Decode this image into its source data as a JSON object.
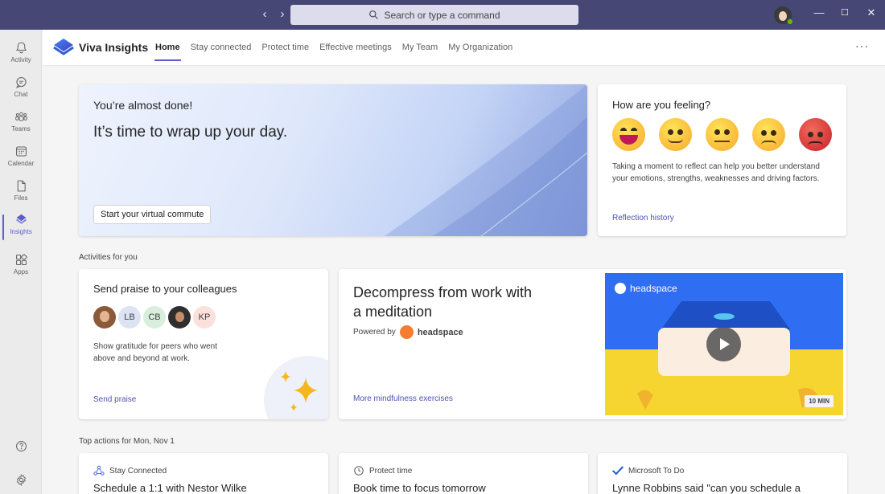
{
  "titlebar": {
    "search_placeholder": "Search or type a command",
    "back_icon": "chevron-left",
    "forward_icon": "chevron-right",
    "min_symbol": "—",
    "max_symbol": "☐",
    "close_symbol": "✕"
  },
  "rail": {
    "items": [
      {
        "label": "Activity",
        "icon": "bell-icon"
      },
      {
        "label": "Chat",
        "icon": "chat-icon"
      },
      {
        "label": "Teams",
        "icon": "teams-icon"
      },
      {
        "label": "Calendar",
        "icon": "calendar-icon"
      },
      {
        "label": "Files",
        "icon": "file-icon"
      },
      {
        "label": "Insights",
        "icon": "insights-icon",
        "active": true
      },
      {
        "label": "Apps",
        "icon": "apps-icon"
      }
    ],
    "help_icon": "help-icon",
    "settings_icon": "gear-icon"
  },
  "app": {
    "name": "Viva Insights",
    "tabs": [
      "Home",
      "Stay connected",
      "Protect time",
      "Effective meetings",
      "My Team",
      "My Organization"
    ],
    "active_tab": "Home",
    "more": "···"
  },
  "hero": {
    "title": "You’re almost done!",
    "subtitle": "It’s time to wrap up your day.",
    "button": "Start your virtual commute"
  },
  "feeling": {
    "title": "How are you feeling?",
    "emojis": [
      "grinning",
      "happy",
      "neutral",
      "worried",
      "angry"
    ],
    "description": "Taking a moment to reflect can help you better understand your emotions, strengths, weaknesses and driving factors.",
    "link": "Reflection history"
  },
  "activities": {
    "section_label": "Activities for you",
    "praise": {
      "title": "Send praise to your colleagues",
      "avatars": [
        "",
        "LB",
        "CB",
        "",
        "KP"
      ],
      "description": "Show gratitude for peers who went above and beyond at work.",
      "link": "Send praise"
    },
    "meditation": {
      "title": "Decompress from work with a meditation",
      "powered_by": "Powered by",
      "brand": "headspace",
      "link": "More mindfulness exercises",
      "video_brand": "headspace",
      "duration": "10 MIN"
    }
  },
  "top_actions": {
    "section_label": "Top actions for Mon, Nov 1",
    "cards": [
      {
        "category": "Stay Connected",
        "title": "Schedule a 1:1 with Nestor Wilke"
      },
      {
        "category": "Protect time",
        "title": "Book time to focus tomorrow"
      },
      {
        "category": "Microsoft To Do",
        "title": "Lynne Robbins said \"can you schedule a"
      }
    ]
  },
  "colors": {
    "titlebar": "#464775",
    "accent": "#5b5fc7",
    "link": "#4f52b2"
  }
}
